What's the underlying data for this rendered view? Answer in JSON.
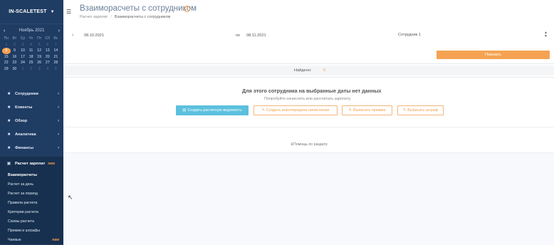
{
  "sidebar": {
    "company": "IN-SCALETEST",
    "calendar": {
      "month": "Ноябрь 2021",
      "weekdays": [
        "Пн",
        "Вт",
        "Ср",
        "Чт",
        "Пт",
        "Сб",
        "Вс"
      ],
      "days": [
        {
          "d": "1",
          "s": "muted"
        },
        {
          "d": "2",
          "s": "muted"
        },
        {
          "d": "3",
          "s": "muted"
        },
        {
          "d": "4",
          "s": "muted"
        },
        {
          "d": "5",
          "s": "muted"
        },
        {
          "d": "6",
          "s": "muted"
        },
        {
          "d": "7",
          "s": "muted"
        },
        {
          "d": "8",
          "s": "today"
        },
        {
          "d": "9",
          "s": ""
        },
        {
          "d": "10",
          "s": ""
        },
        {
          "d": "11",
          "s": ""
        },
        {
          "d": "12",
          "s": ""
        },
        {
          "d": "13",
          "s": ""
        },
        {
          "d": "14",
          "s": ""
        },
        {
          "d": "15",
          "s": ""
        },
        {
          "d": "16",
          "s": ""
        },
        {
          "d": "17",
          "s": ""
        },
        {
          "d": "18",
          "s": ""
        },
        {
          "d": "19",
          "s": ""
        },
        {
          "d": "20",
          "s": ""
        },
        {
          "d": "21",
          "s": ""
        },
        {
          "d": "22",
          "s": ""
        },
        {
          "d": "23",
          "s": ""
        },
        {
          "d": "24",
          "s": ""
        },
        {
          "d": "25",
          "s": ""
        },
        {
          "d": "26",
          "s": ""
        },
        {
          "d": "27",
          "s": ""
        },
        {
          "d": "28",
          "s": ""
        },
        {
          "d": "29",
          "s": ""
        },
        {
          "d": "30",
          "s": ""
        },
        {
          "d": "1",
          "s": "muted"
        },
        {
          "d": "2",
          "s": "muted"
        },
        {
          "d": "3",
          "s": "muted"
        },
        {
          "d": "4",
          "s": "muted"
        },
        {
          "d": "5",
          "s": "muted"
        }
      ]
    },
    "menu": [
      {
        "label": "Сотрудники",
        "icon": "users-icon",
        "glyph": "👤"
      },
      {
        "label": "Клиенты",
        "icon": "people-icon",
        "glyph": "👥"
      },
      {
        "label": "Обзор",
        "icon": "grid-icon",
        "glyph": "▦"
      },
      {
        "label": "Аналитика",
        "icon": "chart-icon",
        "glyph": "📈"
      },
      {
        "label": "Финансы",
        "icon": "coins-icon",
        "glyph": "💰"
      }
    ],
    "active_section": {
      "label": "Расчет зарплат",
      "icon": "wallet-icon",
      "badge": "new"
    },
    "submenu": [
      {
        "label": "Взаиморасчеты",
        "badge": ""
      },
      {
        "label": "Расчет за день",
        "badge": ""
      },
      {
        "label": "Расчет за период",
        "badge": ""
      },
      {
        "label": "Правила расчета",
        "badge": ""
      },
      {
        "label": "Критерии расчета",
        "badge": ""
      },
      {
        "label": "Схемы расчета",
        "badge": ""
      },
      {
        "label": "Премии и штрафы",
        "badge": ""
      },
      {
        "label": "Чаевые",
        "badge": "new"
      }
    ]
  },
  "header": {
    "title": "Взаиморасчеты с сотрудником",
    "breadcrumb": [
      "Расчет зарплат",
      "Взаиморасчеты с сотрудником"
    ]
  },
  "filters": {
    "date_from": "08.10.2021",
    "to_label": "по",
    "date_to": "08.11.2021",
    "employee": "Сотрудник 1",
    "show_button": "Показать"
  },
  "result": {
    "found_label": "Найдено:",
    "found_value": "0",
    "empty_title": "Для этого сотрудника на выбранные даты нет данных",
    "empty_subtitle": "Попробуйте начислить или рассчитать зарплату."
  },
  "actions": {
    "create": "Создать расчетную ведомость",
    "extra": "Создать внеочередное начисление",
    "bonus": "Выписать премию",
    "fine": "Выписать штраф"
  },
  "help": "Помощь по разделу",
  "colors": {
    "sidebar": "#1f3c63",
    "accent": "#f5a352",
    "info": "#5bc0de"
  }
}
